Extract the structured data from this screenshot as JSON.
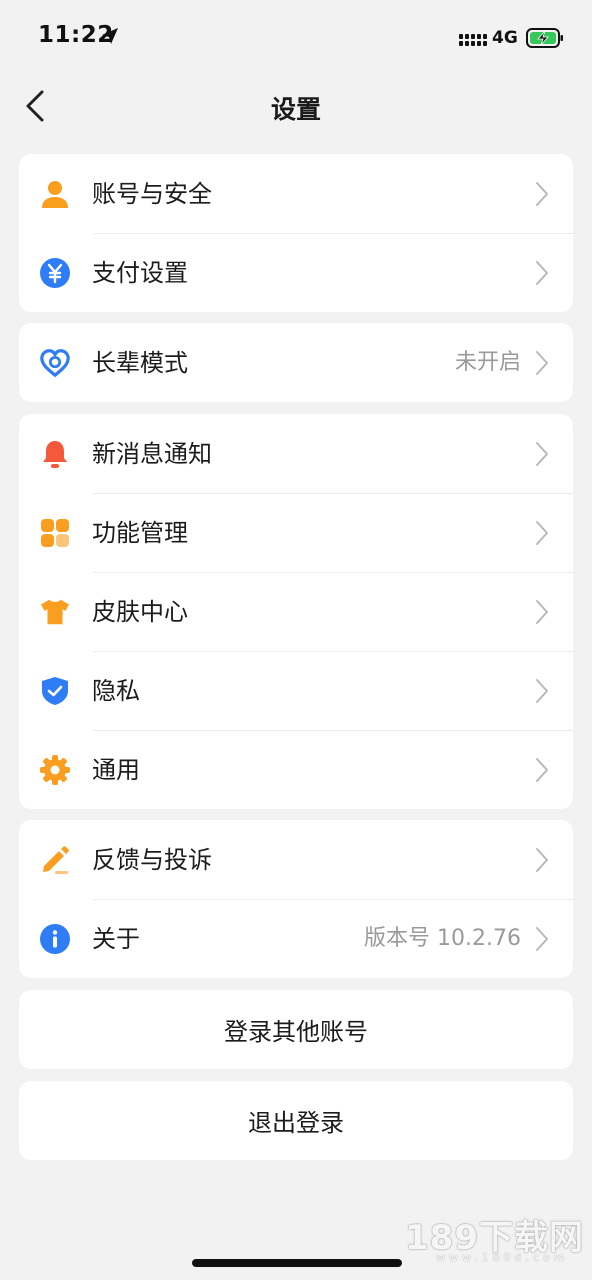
{
  "status_bar": {
    "time": "11:22",
    "network": "4G",
    "icons": [
      "location-arrow-icon",
      "cellular-signal-icon",
      "battery-charging-icon"
    ]
  },
  "nav": {
    "title": "设置",
    "back_icon": "chevron-left-icon"
  },
  "groups": [
    {
      "items": [
        {
          "label": "账号与安全",
          "icon": "user-icon",
          "value": ""
        },
        {
          "label": "支付设置",
          "icon": "yuan-coin-icon",
          "value": ""
        }
      ]
    },
    {
      "items": [
        {
          "label": "长辈模式",
          "icon": "heart-icon",
          "value": "未开启"
        }
      ]
    },
    {
      "items": [
        {
          "label": "新消息通知",
          "icon": "bell-icon",
          "value": ""
        },
        {
          "label": "功能管理",
          "icon": "grid-icon",
          "value": ""
        },
        {
          "label": "皮肤中心",
          "icon": "tshirt-icon",
          "value": ""
        },
        {
          "label": "隐私",
          "icon": "shield-check-icon",
          "value": ""
        },
        {
          "label": "通用",
          "icon": "gear-icon",
          "value": ""
        }
      ]
    },
    {
      "items": [
        {
          "label": "反馈与投诉",
          "icon": "pencil-icon",
          "value": ""
        },
        {
          "label": "关于",
          "icon": "info-icon",
          "value": "版本号 10.2.76"
        }
      ]
    }
  ],
  "actions": {
    "switch_account": "登录其他账号",
    "logout": "退出登录"
  },
  "watermark": {
    "text": "189下载网",
    "sub": "www.189d.com"
  },
  "colors": {
    "background": "#f2f2f2",
    "card": "#ffffff",
    "orange": "#fa9e20",
    "blue": "#2f7df6",
    "red": "#f5593b",
    "muted_text": "#9a9a9a"
  }
}
